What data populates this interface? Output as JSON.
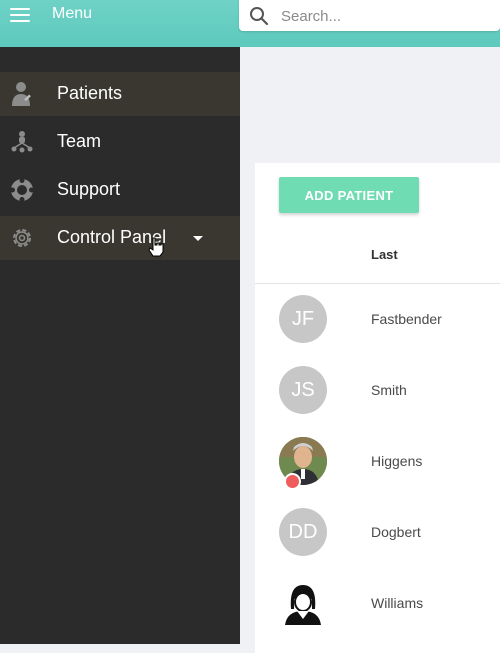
{
  "header": {
    "menu_label": "Menu",
    "search_placeholder": "Search..."
  },
  "sidebar": {
    "items": [
      {
        "label": "Patients",
        "icon": "patient-icon",
        "active": true
      },
      {
        "label": "Team",
        "icon": "team-icon",
        "active": false
      },
      {
        "label": "Support",
        "icon": "lifebuoy-icon",
        "active": false
      },
      {
        "label": "Control Panel",
        "icon": "gear-icon",
        "active": true,
        "has_dropdown": true
      }
    ]
  },
  "main": {
    "add_button_label": "ADD PATIENT",
    "column_header": "Last",
    "patients": [
      {
        "initials": "JF",
        "last": "Fastbender",
        "avatar": "initials"
      },
      {
        "initials": "JS",
        "last": "Smith",
        "avatar": "initials"
      },
      {
        "initials": "",
        "last": "Higgens",
        "avatar": "photo",
        "status": "offline"
      },
      {
        "initials": "DD",
        "last": "Dogbert",
        "avatar": "initials"
      },
      {
        "initials": "",
        "last": "Williams",
        "avatar": "illustration"
      }
    ]
  },
  "colors": {
    "header": "#5ec9bd",
    "sidebar": "#2b2b2b",
    "sidebar_active": "#39372f",
    "add_button": "#6fdcb3",
    "avatar_initials_bg": "#c7c7c7",
    "status_offline": "#ee5d5b"
  }
}
